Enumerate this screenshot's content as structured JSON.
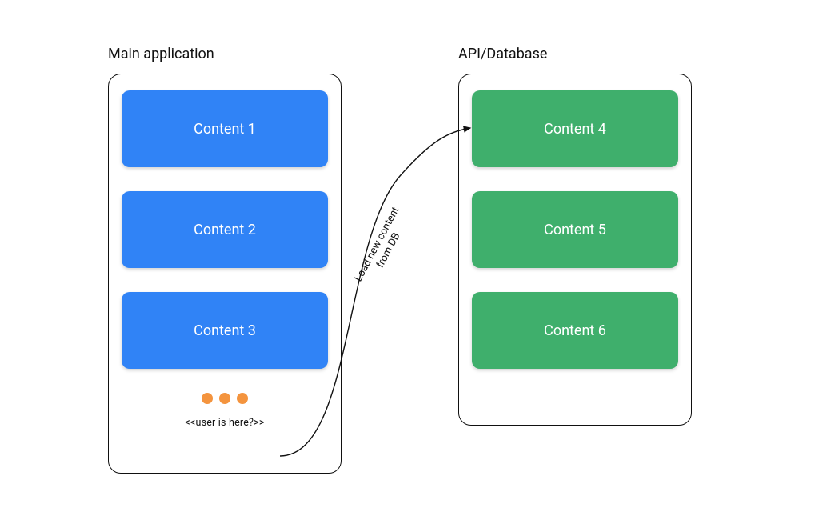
{
  "left": {
    "title": "Main application",
    "cards": [
      "Content 1",
      "Content 2",
      "Content 3"
    ],
    "user_here": "<<user is here?>>"
  },
  "right": {
    "title": "API/Database",
    "cards": [
      "Content 4",
      "Content 5",
      "Content 6"
    ]
  },
  "connector": {
    "line1": "Load new content",
    "line2": "from DB"
  },
  "colors": {
    "blue": "#3083F6",
    "green": "#3FAF6C",
    "dot": "#F4943E"
  }
}
